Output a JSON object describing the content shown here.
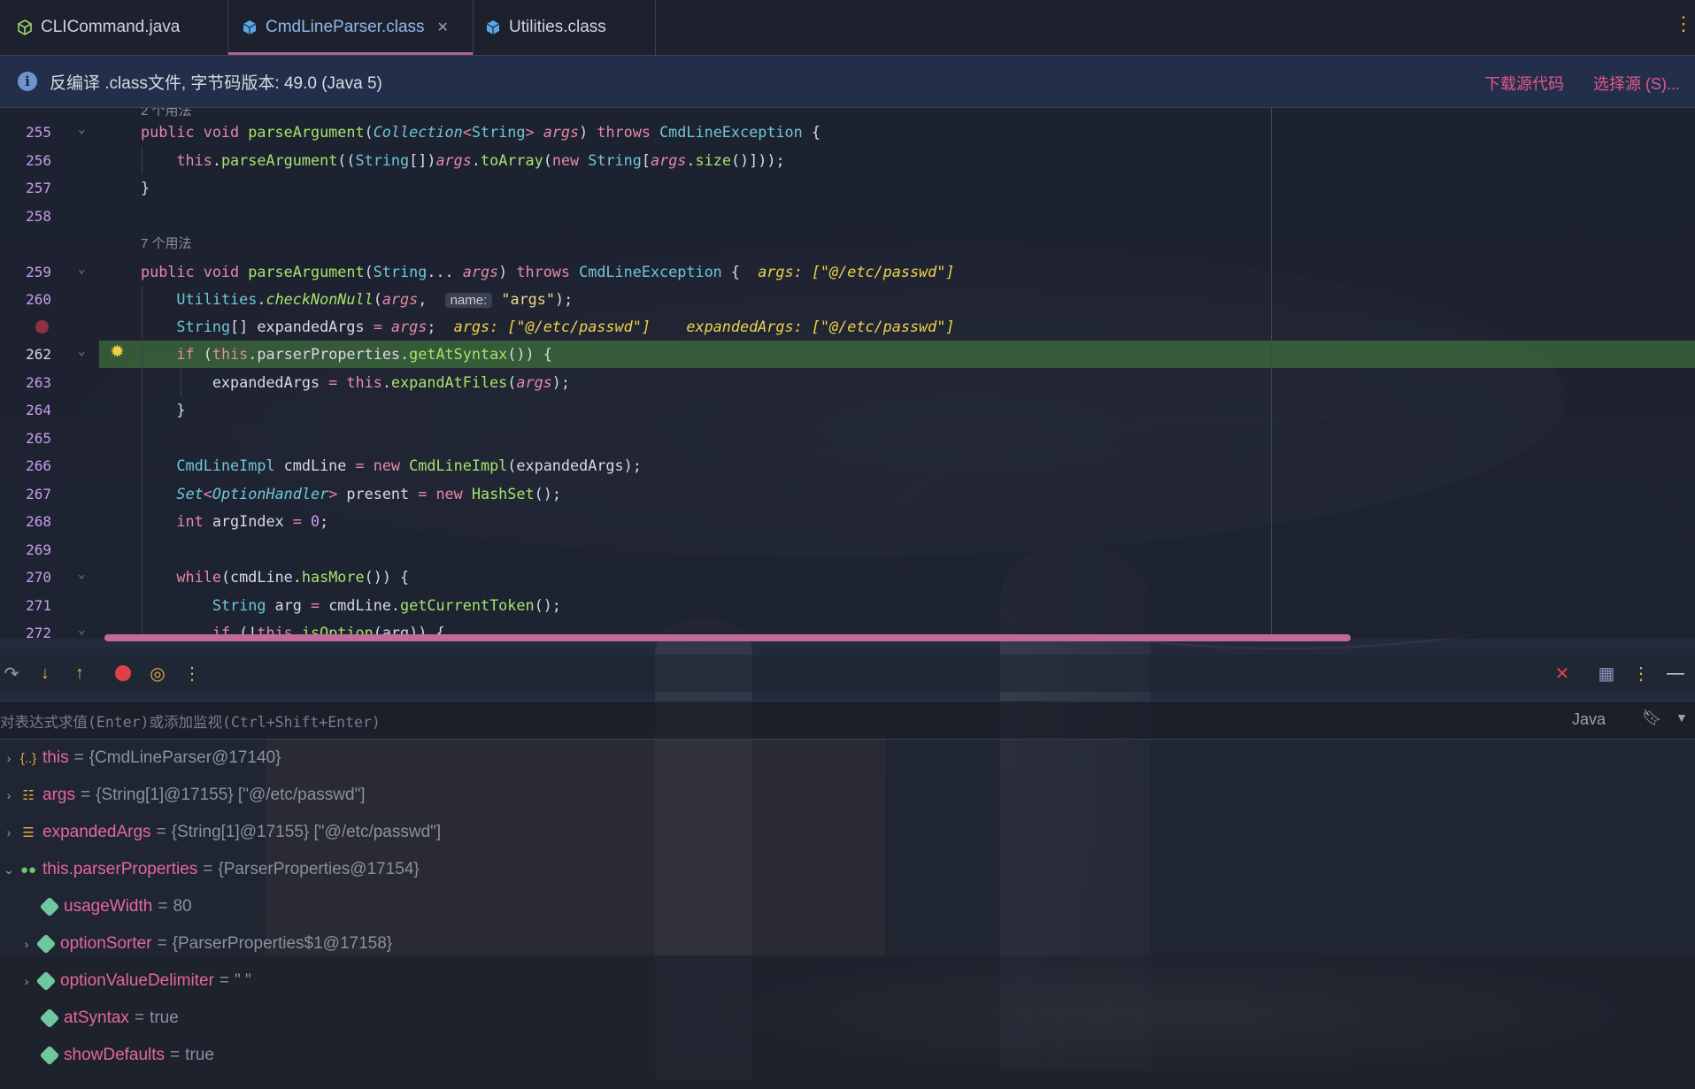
{
  "tabs": [
    {
      "label": "CLICommand.java",
      "icon": "java-file-icon",
      "active": false,
      "closable": false
    },
    {
      "label": "CmdLineParser.class",
      "icon": "class-file-icon",
      "active": true,
      "closable": true
    },
    {
      "label": "Utilities.class",
      "icon": "class-file-icon",
      "active": false,
      "closable": false
    }
  ],
  "banner": {
    "message": "反编译 .class文件, 字节码版本: 49.0 (Java 5)",
    "download_label": "下载源代码",
    "choose_label": "选择源 (S)..."
  },
  "editor": {
    "usages_partial": "2 个用法",
    "usages_7": "7 个用法",
    "line_numbers": [
      "255",
      "256",
      "257",
      "258",
      "259",
      "260",
      "",
      "262",
      "263",
      "264",
      "265",
      "266",
      "267",
      "268",
      "269",
      "270",
      "271",
      "272"
    ],
    "current_line": "262",
    "inlay_name": "name:",
    "hint_259": "args: [\"@/etc/passwd\"]",
    "hint_261_args": "args: [\"@/etc/passwd\"]",
    "hint_261_expanded": "expandedArgs: [\"@/etc/passwd\"]"
  },
  "debugger": {
    "eval_placeholder": "对表达式求值(Enter)或添加监视(Ctrl+Shift+Enter)",
    "language": "Java",
    "variables": [
      {
        "name": "this",
        "value": "{CmdLineParser@17140}",
        "icon": "object-icon",
        "expandable": true,
        "expanded": false,
        "level": 0
      },
      {
        "name": "args",
        "value": "{String[1]@17155} [\"@/etc/passwd\"]",
        "icon": "array-param-icon",
        "expandable": true,
        "expanded": false,
        "level": 0
      },
      {
        "name": "expandedArgs",
        "value": "{String[1]@17155} [\"@/etc/passwd\"]",
        "icon": "list-icon",
        "expandable": true,
        "expanded": false,
        "level": 0
      },
      {
        "name": "this.parserProperties",
        "value": "{ParserProperties@17154}",
        "icon": "watch-icon",
        "expandable": true,
        "expanded": true,
        "level": 0
      },
      {
        "name": "usageWidth",
        "value": "80",
        "icon": "field-tag-icon",
        "expandable": false,
        "expanded": false,
        "level": 1
      },
      {
        "name": "optionSorter",
        "value": "{ParserProperties$1@17158}",
        "icon": "field-tag-icon",
        "expandable": true,
        "expanded": false,
        "level": 1
      },
      {
        "name": "optionValueDelimiter",
        "value": "\" \"",
        "icon": "field-tag-icon",
        "expandable": true,
        "expanded": false,
        "level": 1
      },
      {
        "name": "atSyntax",
        "value": "true",
        "icon": "field-tag-icon",
        "expandable": false,
        "expanded": false,
        "level": 1
      },
      {
        "name": "showDefaults",
        "value": "true",
        "icon": "field-tag-icon",
        "expandable": false,
        "expanded": false,
        "level": 1
      }
    ]
  },
  "colors": {
    "accent_tab": "#b25f9d",
    "link": "#e2588d",
    "exec_line": "#42783e",
    "var_name": "#e7679a",
    "breakpoint": "#e0404a"
  }
}
